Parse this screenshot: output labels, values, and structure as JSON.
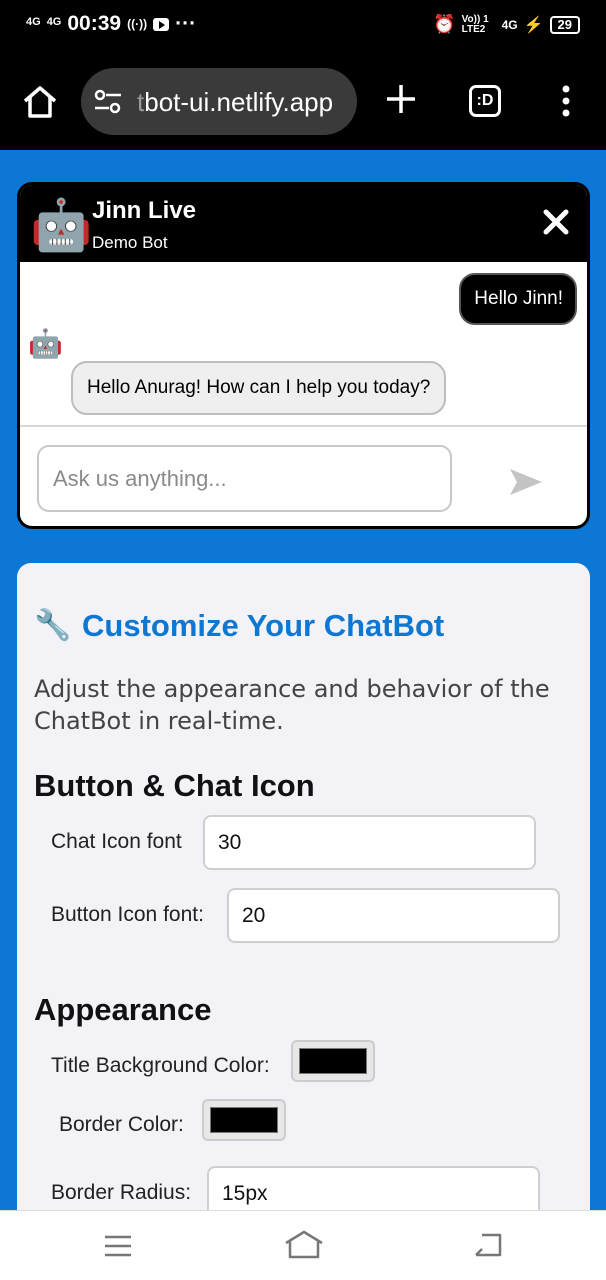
{
  "status_bar": {
    "network_1": "4G",
    "network_2": "4G",
    "time": "00:39",
    "more": "···",
    "lte": "Vo)) 1 LTE2",
    "net_right": "4G",
    "battery": "29"
  },
  "browser": {
    "url_faded": "t",
    "url": "bot-ui.netlify.app",
    "tabs_label": ":D"
  },
  "chat": {
    "title": "Jinn Live",
    "subtitle": "Demo Bot",
    "messages": [
      {
        "from": "user",
        "text": "Hello Jinn!"
      },
      {
        "from": "bot",
        "text": "Hello Anurag! How can I help you today?"
      }
    ],
    "input_placeholder": "Ask us anything..."
  },
  "panel": {
    "title": "Customize Your ChatBot",
    "description": "Adjust the appearance and behavior of the ChatBot in real-time.",
    "sections": {
      "button_icon": {
        "heading": "Button & Chat Icon",
        "chat_icon_font_label": "Chat Icon font",
        "chat_icon_font_value": "30",
        "button_icon_font_label": "Button Icon font:",
        "button_icon_font_value": "20"
      },
      "appearance": {
        "heading": "Appearance",
        "title_bg_label": "Title Background Color:",
        "title_bg_color": "#000000",
        "border_color_label": "Border Color:",
        "border_color": "#000000",
        "border_radius_label": "Border Radius:",
        "border_radius_value": "15px"
      }
    }
  },
  "colors": {
    "page_bg": "#0d77d4",
    "accent": "#0d77d4",
    "header_bg": "#000000"
  }
}
